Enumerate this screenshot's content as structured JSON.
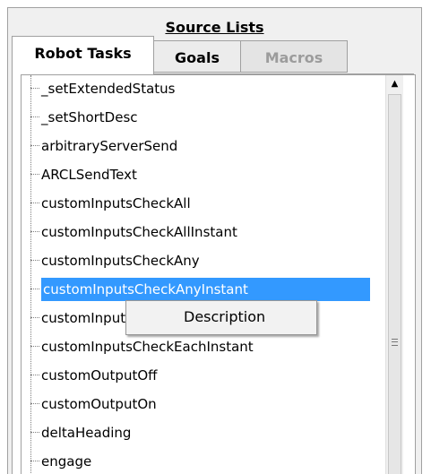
{
  "panel": {
    "title": "Source Lists"
  },
  "tabs": [
    {
      "label": "Robot Tasks",
      "state": "active"
    },
    {
      "label": "Goals",
      "state": "inactive"
    },
    {
      "label": "Macros",
      "state": "disabled"
    }
  ],
  "list": {
    "items": [
      "_setExtendedStatus",
      "_setShortDesc",
      "arbitraryServerSend",
      "ARCLSendText",
      "customInputsCheckAll",
      "customInputsCheckAllInstant",
      "customInputsCheckAny",
      "customInputsCheckAnyInstant",
      "customInputsCheckEach",
      "customInputsCheckEachInstant",
      "customOutputOff",
      "customOutputOn",
      "deltaHeading",
      "engage"
    ],
    "selected_index": 7
  },
  "context_menu": {
    "items": [
      "Description"
    ]
  },
  "colors": {
    "selection": "#3399ff",
    "disabled_text": "#9c9c9c"
  },
  "icons": {
    "scroll_up": "triangle-up-icon",
    "scroll_grip": "grip-lines-icon"
  }
}
